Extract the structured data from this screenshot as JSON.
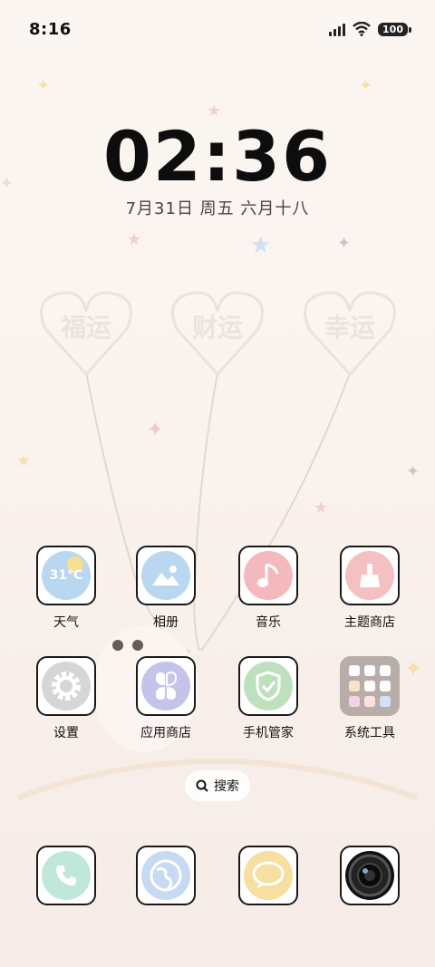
{
  "status_bar": {
    "time": "8:16",
    "battery": "100"
  },
  "lock_widget": {
    "clock": "02:36",
    "date": "7月31日 周五 六月十八"
  },
  "wallpaper": {
    "balloons": [
      "福运",
      "财运",
      "幸运"
    ]
  },
  "apps": [
    {
      "label": "天气",
      "weather_temp": "31°C"
    },
    {
      "label": "相册"
    },
    {
      "label": "音乐"
    },
    {
      "label": "主题商店"
    },
    {
      "label": "设置"
    },
    {
      "label": "应用商店"
    },
    {
      "label": "手机管家"
    },
    {
      "label": "系统工具"
    }
  ],
  "search": {
    "label": "搜索"
  },
  "dock": [
    {
      "icon": "phone-icon"
    },
    {
      "icon": "browser-icon"
    },
    {
      "icon": "messages-icon"
    },
    {
      "icon": "camera-icon"
    }
  ],
  "colors": {
    "weather": "#b9d7f0",
    "gallery": "#b9d7f0",
    "music": "#f4b9bc",
    "theme": "#f4c0c2",
    "settings": "#d6d6d6",
    "appstore": "#c4c4ea",
    "security": "#bfe0bf",
    "phone": "#bfe8d8",
    "browser": "#c6daf2",
    "messages": "#f6dfa0"
  }
}
